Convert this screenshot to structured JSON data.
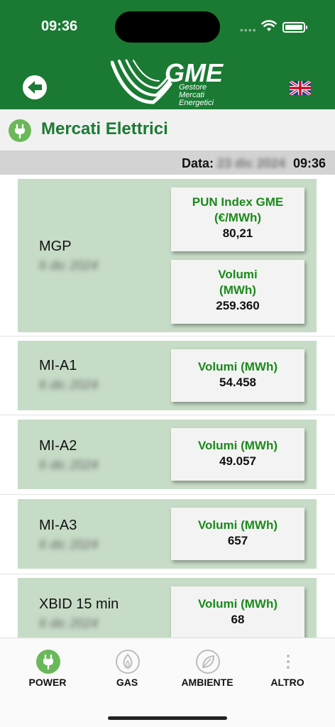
{
  "status": {
    "time": "09:36"
  },
  "header": {
    "logo_text": "GME",
    "logo_sub_1": "Gestore",
    "logo_sub_2": "Mercati",
    "logo_sub_3": "Energetici",
    "brand_color": "#1a7a33"
  },
  "section": {
    "title": "Mercati Elettrici",
    "icon": "plug-icon"
  },
  "date_bar": {
    "label": "Data:",
    "value": "23 dic 2024",
    "time": "09:36"
  },
  "markets": [
    {
      "name": "MGP",
      "date": "6 dic 2024",
      "boxes": [
        {
          "title": "PUN Index GME (€/MWh)",
          "value": "80,21"
        },
        {
          "title": "Volumi (MWh)",
          "value": "259.360"
        }
      ]
    },
    {
      "name": "MI-A1",
      "date": "6 dic 2024",
      "boxes": [
        {
          "title": "Volumi (MWh)",
          "value": "54.458"
        }
      ]
    },
    {
      "name": "MI-A2",
      "date": "6 dic 2024",
      "boxes": [
        {
          "title": "Volumi (MWh)",
          "value": "49.057"
        }
      ]
    },
    {
      "name": "MI-A3",
      "date": "6 dic 2024",
      "boxes": [
        {
          "title": "Volumi (MWh)",
          "value": "657"
        }
      ]
    },
    {
      "name": "XBID 15 min",
      "date": "6 dic 2024",
      "boxes": [
        {
          "title": "Volumi (MWh)",
          "value": "68"
        }
      ]
    }
  ],
  "nav": [
    {
      "label": "POWER",
      "icon": "power-plug-icon",
      "active": true
    },
    {
      "label": "GAS",
      "icon": "flame-icon",
      "active": false
    },
    {
      "label": "AMBIENTE",
      "icon": "leaf-icon",
      "active": false
    },
    {
      "label": "ALTRO",
      "icon": "more-dots-icon",
      "active": false
    }
  ]
}
